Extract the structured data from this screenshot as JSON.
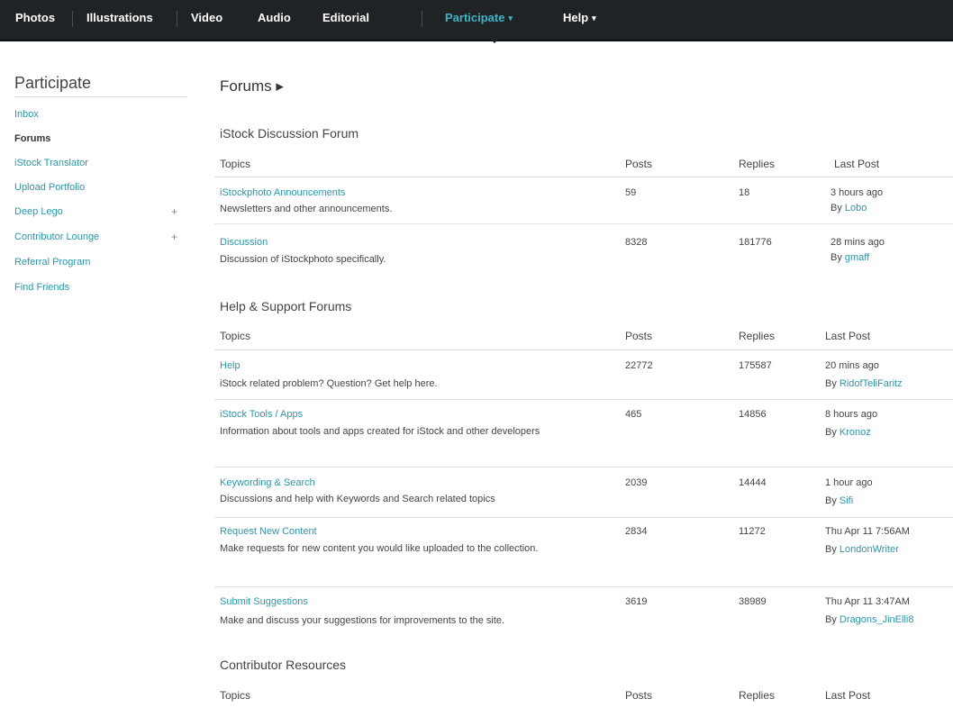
{
  "nav": {
    "items": [
      "Photos",
      "Illustrations",
      "Video",
      "Audio",
      "Editorial"
    ],
    "participate_label": "Participate",
    "help_label": "Help",
    "caret": "▾"
  },
  "sidebar": {
    "title": "Participate",
    "items": [
      {
        "label": "Inbox"
      },
      {
        "label": "Forums"
      },
      {
        "label": "iStock Translator"
      },
      {
        "label": "Upload Portfolio"
      },
      {
        "label": "Deep Lego",
        "expand": "+"
      },
      {
        "label": "Contributor Lounge",
        "expand": "+"
      },
      {
        "label": "Referral Program"
      },
      {
        "label": "Find Friends"
      }
    ]
  },
  "main": {
    "page_title": "Forums ▸",
    "columns": {
      "topics": "Topics",
      "posts": "Posts",
      "replies": "Replies",
      "last_post": "Last Post"
    },
    "sections": [
      {
        "title": "iStock Discussion Forum",
        "forums": [
          {
            "name": "iStockphoto Announcements",
            "desc": "Newsletters and other announcements.",
            "posts": "59",
            "replies": "18",
            "last_time": "3 hours ago",
            "by": "By",
            "user": "Lobo"
          },
          {
            "name": "Discussion",
            "desc": "Discussion of iStockphoto specifically.",
            "posts": "8328",
            "replies": "181776",
            "last_time": "28 mins ago",
            "by": "By",
            "user": "gmaff"
          }
        ]
      },
      {
        "title": "Help & Support Forums",
        "forums": [
          {
            "name": "Help",
            "desc": "iStock related problem? Question? Get help here.",
            "posts": "22772",
            "replies": "175587",
            "last_time": "20 mins ago",
            "by": "By",
            "user": "RidofTeliFaritz"
          },
          {
            "name": "iStock Tools / Apps",
            "desc": "Information about tools and apps created for iStock and other developers",
            "posts": "465",
            "replies": "14856",
            "last_time": "8 hours ago",
            "by": "By",
            "user": "Kronoz"
          },
          {
            "name": "Keywording & Search",
            "desc": "Discussions and help with Keywords and Search related topics",
            "posts": "2039",
            "replies": "14444",
            "last_time": "1 hour ago",
            "by": "By",
            "user": "Sifi"
          },
          {
            "name": "Request New Content",
            "desc": "Make requests for new content you would like uploaded to the collection.",
            "posts": "2834",
            "replies": "11272",
            "last_time": "Thu Apr 11 7:56AM",
            "by": "By",
            "user": "LondonWriter"
          },
          {
            "name": "Submit Suggestions",
            "desc": "Make and discuss your suggestions for improvements to the site.",
            "posts": "3619",
            "replies": "38989",
            "last_time": "Thu Apr 11 3:47AM",
            "by": "By",
            "user": "Dragons_JinElli8"
          }
        ]
      },
      {
        "title": "Contributor Resources",
        "forums": []
      }
    ]
  }
}
